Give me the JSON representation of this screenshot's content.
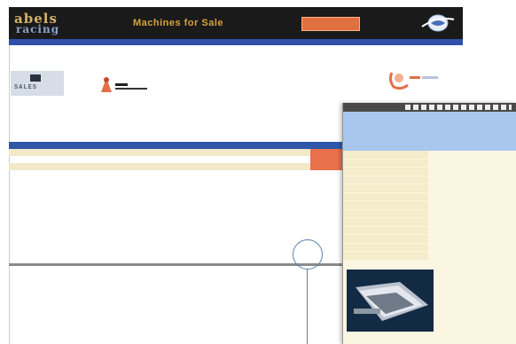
{
  "header": {
    "logo_line1": "abels",
    "logo_line2": "racing",
    "title": "Machines for Sale",
    "button_label": ""
  },
  "nav": {
    "left": "",
    "right": ""
  },
  "left_panel": {
    "badge_text": "SALES"
  },
  "table": {
    "headers": [
      "",
      "",
      "",
      "",
      "",
      "",
      "",
      ""
    ],
    "rows": [
      [
        "",
        "",
        "",
        "",
        "",
        "",
        "",
        ""
      ],
      [
        "",
        "",
        "",
        "",
        "",
        "",
        "",
        ""
      ],
      [
        "",
        "",
        "",
        "",
        "",
        "",
        "",
        ""
      ]
    ]
  },
  "popup": {
    "bar_title": "",
    "head_title": "",
    "spec_rows": [
      {
        "label": "",
        "value": ""
      },
      {
        "label": "",
        "value": ""
      },
      {
        "label": "",
        "value": ""
      },
      {
        "label": "",
        "value": ""
      },
      {
        "label": "",
        "value": ""
      },
      {
        "label": "",
        "value": ""
      },
      {
        "label": "",
        "value": ""
      },
      {
        "label": "",
        "value": ""
      },
      {
        "label": "",
        "value": ""
      },
      {
        "label": "",
        "value": ""
      },
      {
        "label": "",
        "value": ""
      },
      {
        "label": "",
        "value": ""
      },
      {
        "label": "",
        "value": ""
      }
    ]
  },
  "colors": {
    "header_bg": "#1a1a1a",
    "title_color": "#d8a33c",
    "accent_orange": "#e07040",
    "nav_blue": "#2f4fa8",
    "table_head_blue": "#2f58a8",
    "row_highlight": "#f2e9c8",
    "popup_head": "#a9c6ef",
    "popup_bg": "#fbf6e1"
  },
  "icons": [
    "globe-logo-icon",
    "toy-figure-icon",
    "partner-logo-icon",
    "machine-photo"
  ]
}
